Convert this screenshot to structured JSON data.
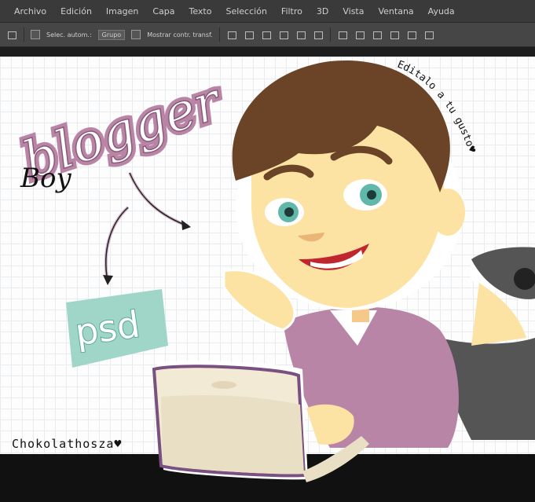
{
  "menu": [
    "Archivo",
    "Edición",
    "Imagen",
    "Capa",
    "Texto",
    "Selección",
    "Filtro",
    "3D",
    "Vista",
    "Ventana",
    "Ayuda"
  ],
  "options": {
    "auto_select_label": "Selec. autom.:",
    "group_value": "Grupo",
    "show_transform_label": "Mostrar contr. transf."
  },
  "artwork": {
    "title_main": "blogger",
    "title_sub": "Boy",
    "badge": "psd",
    "side_text": "Editalo a tu gusto♥",
    "credit": "Chokolathosza♥"
  },
  "colors": {
    "canvas_bg": "#fdfdfd",
    "purple": "#b985a6",
    "mint": "#9fd6c8",
    "skin": "#fde3a3",
    "hair": "#6b4326"
  }
}
